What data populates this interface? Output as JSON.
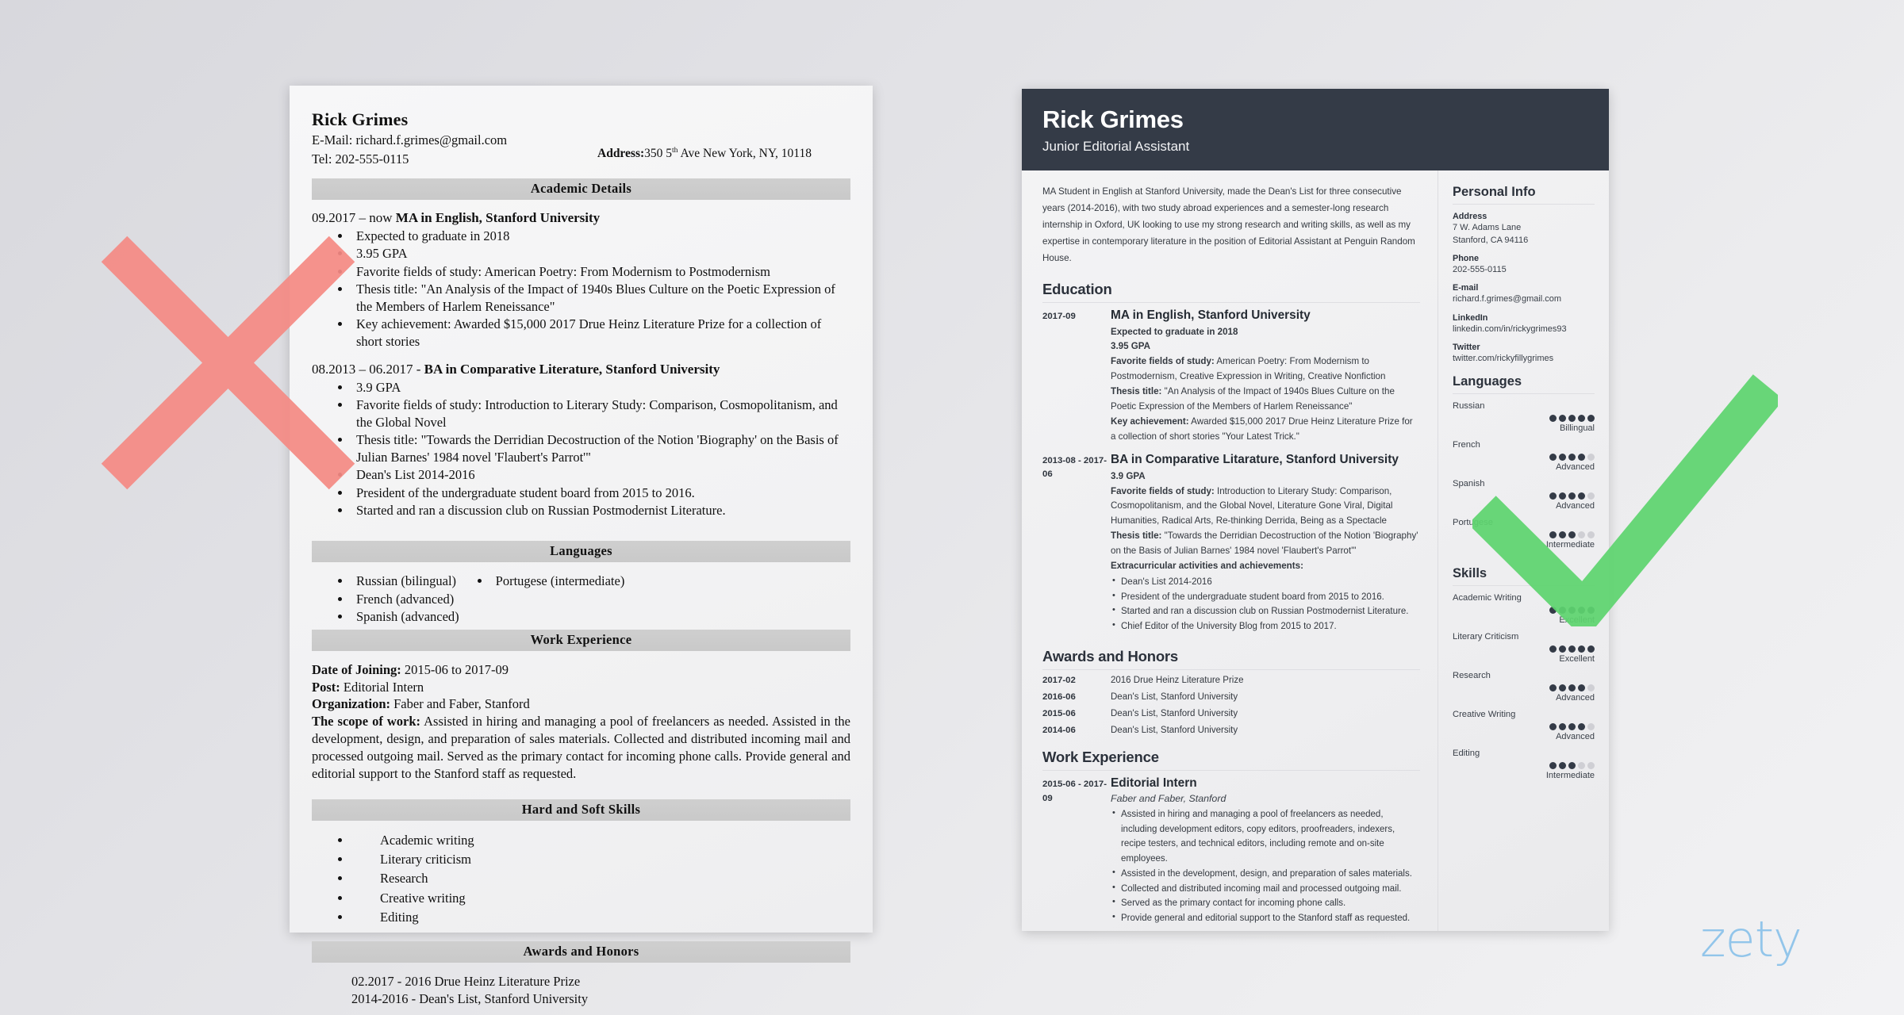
{
  "colors": {
    "accent_dark": "#343b47",
    "mark_red": "#f58a84",
    "mark_green": "#5ed46f",
    "logo_blue": "#92c5ea",
    "dot_on": "#343b47",
    "dot_off": "#cfcfd4"
  },
  "bad_resume": {
    "name": "Rick Grimes",
    "email_line": "E-Mail: richard.f.grimes@gmail.com",
    "tel_line": "Tel: 202-555-0115",
    "address_label": "Address:",
    "address_value_a": "350 5",
    "address_value_sup": "th",
    "address_value_b": " Ave New York, NY, 10118",
    "sections": {
      "academic": "Academic Details",
      "languages": "Languages",
      "work": "Work Experience",
      "skills": "Hard and Soft Skills",
      "awards": "Awards and Honors"
    },
    "edu1": {
      "dates": "09.2017 – now ",
      "title": "MA in English, Stanford University",
      "bullets": [
        "Expected to graduate in 2018",
        "3.95 GPA",
        "Favorite fields of study: American Poetry: From Modernism to Postmodernism",
        "Thesis title: \"An Analysis of the Impact of 1940s Blues Culture on the Poetic Expression of the Members of Harlem Reneissance\"",
        "Key achievement: Awarded $15,000 2017 Drue Heinz Literature Prize for a collection of short stories"
      ]
    },
    "edu2": {
      "dates": "08.2013 – 06.2017 - ",
      "title": "BA in Comparative Literature, Stanford University",
      "bullets": [
        "3.9 GPA",
        "Favorite fields of study: Introduction to Literary Study: Comparison, Cosmopolitanism, and the Global Novel",
        "Thesis title: \"Towards the Derridian Decostruction of the Notion 'Biography' on the Basis of Julian Barnes' 1984 novel 'Flaubert's Parrot'\"",
        "Dean's List 2014-2016",
        "President of the undergraduate student board from 2015 to 2016.",
        "Started and ran a discussion club on Russian Postmodernist Literature."
      ]
    },
    "languages_col1": [
      "Russian  (bilingual)",
      "French (advanced)",
      "Spanish (advanced)"
    ],
    "languages_col2": [
      "Portugese (intermediate)"
    ],
    "work": {
      "date_label": "Date of Joining:",
      "date_value": " 2015-06 to 2017-09",
      "post_label": "Post:",
      "post_value": " Editorial Intern",
      "org_label": "Organization:",
      "org_value": " Faber and Faber, Stanford",
      "scope_label": "The scope of work:",
      "scope_value": " Assisted in hiring and managing a pool of freelancers as needed. Assisted in the development, design, and preparation of sales materials. Collected and distributed incoming mail and processed outgoing mail. Served as the primary contact for incoming phone calls. Provide general and editorial support to the Stanford staff as requested."
    },
    "skills": [
      "Academic writing",
      "Literary criticism",
      "Research",
      "Creative writing",
      "Editing"
    ],
    "awards": [
      "02.2017 - 2016 Drue Heinz Literature Prize",
      "2014-2016 - Dean's List, Stanford University"
    ]
  },
  "good_resume": {
    "name": "Rick Grimes",
    "job_title": "Junior Editorial Assistant",
    "summary": "MA Student in English at Stanford University, made the Dean's List for three consecutive years (2014-2016), with two study abroad experiences and a semester-long research internship in Oxford, UK looking to use my strong research and writing skills, as well as my expertise in contemporary literature in the position of Editorial Assistant at Penguin Random House.",
    "sections": {
      "education": "Education",
      "awards": "Awards and Honors",
      "work": "Work Experience",
      "personal_info": "Personal Info",
      "languages": "Languages",
      "skills": "Skills"
    },
    "education": [
      {
        "date": "2017-09",
        "title": "MA in English, Stanford University",
        "lines": [
          {
            "bold": "Expected to graduate in 2018",
            "text": ""
          },
          {
            "bold": "3.95 GPA",
            "text": ""
          },
          {
            "bold": "Favorite fields of study:",
            "text": " American Poetry: From Modernism to Postmodernism, Creative Expression in Writing, Creative Nonfiction"
          },
          {
            "bold": "Thesis title:",
            "text": " \"An Analysis of the Impact of 1940s Blues Culture on the Poetic Expression of the Members of Harlem Reneissance\""
          },
          {
            "bold": "Key achievement:",
            "text": " Awarded $15,000 2017 Drue Heinz Literature Prize for a collection of short stories \"Your Latest Trick.\""
          }
        ],
        "bullets": []
      },
      {
        "date": "2013-08 - 2017-06",
        "title": "BA in Comparative Litarature, Stanford University",
        "lines": [
          {
            "bold": "3.9 GPA",
            "text": ""
          },
          {
            "bold": "Favorite fields of study:",
            "text": " Introduction to Literary Study: Comparison, Cosmopolitanism, and the Global Novel, Literature Gone Viral, Digital Humanities, Radical Arts, Re-thinking Derrida, Being as a Spectacle"
          },
          {
            "bold": "Thesis title:",
            "text": " \"Towards the Derridian Decostruction of the Notion 'Biography' on the Basis of Julian Barnes' 1984 novel 'Flaubert's Parrot'\""
          },
          {
            "bold": "Extracurricular activities and achievements:",
            "text": ""
          }
        ],
        "bullets": [
          "Dean's List 2014-2016",
          "President of the undergraduate student board from 2015 to 2016.",
          "Started and ran a discussion club on Russian Postmodernist Literature.",
          "Chief Editor of the University Blog from 2015 to 2017."
        ]
      }
    ],
    "awards": [
      {
        "date": "2017-02",
        "text": "2016 Drue Heinz Literature Prize"
      },
      {
        "date": "2016-06",
        "text": "Dean's List, Stanford University"
      },
      {
        "date": "2015-06",
        "text": "Dean's List, Stanford University"
      },
      {
        "date": "2014-06",
        "text": "Dean's List, Stanford University"
      }
    ],
    "work": [
      {
        "date": "2015-06 - 2017-09",
        "title": "Editorial Intern",
        "subtitle": "Faber and Faber, Stanford",
        "bullets": [
          "Assisted in hiring and managing a pool of freelancers as needed, including development editors, copy editors, proofreaders, indexers, recipe testers, and technical editors, including remote and on-site employees.",
          "Assisted in the development, design, and preparation of sales materials.",
          "Collected and distributed incoming mail and processed outgoing mail.",
          "Served as the primary contact for incoming phone calls.",
          "Provide general and editorial support to the Stanford staff as requested."
        ]
      }
    ],
    "personal_info": [
      {
        "label": "Address",
        "values": [
          "7 W. Adams Lane",
          "Stanford, CA 94116"
        ]
      },
      {
        "label": "Phone",
        "values": [
          "202-555-0115"
        ]
      },
      {
        "label": "E-mail",
        "values": [
          "richard.f.grimes@gmail.com"
        ]
      },
      {
        "label": "LinkedIn",
        "values": [
          "linkedin.com/in/rickygrimes93"
        ]
      },
      {
        "label": "Twitter",
        "values": [
          "twitter.com/rickyfillygrimes"
        ]
      }
    ],
    "languages": [
      {
        "name": "Russian",
        "filled": 5,
        "total": 5,
        "level": "Billingual"
      },
      {
        "name": "French",
        "filled": 4,
        "total": 5,
        "level": "Advanced"
      },
      {
        "name": "Spanish",
        "filled": 4,
        "total": 5,
        "level": "Advanced"
      },
      {
        "name": "Portugese",
        "filled": 3,
        "total": 5,
        "level": "Intermediate"
      }
    ],
    "skills": [
      {
        "name": "Academic Writing",
        "filled": 5,
        "total": 5,
        "level": "Excellent"
      },
      {
        "name": "Literary Criticism",
        "filled": 5,
        "total": 5,
        "level": "Excellent"
      },
      {
        "name": "Research",
        "filled": 4,
        "total": 5,
        "level": "Advanced"
      },
      {
        "name": "Creative Writing",
        "filled": 4,
        "total": 5,
        "level": "Advanced"
      },
      {
        "name": "Editing",
        "filled": 3,
        "total": 5,
        "level": "Intermediate"
      }
    ]
  },
  "branding": {
    "logo_text": "zety"
  },
  "annotations": {
    "reject_mark": "x-mark",
    "approve_mark": "check-mark"
  }
}
